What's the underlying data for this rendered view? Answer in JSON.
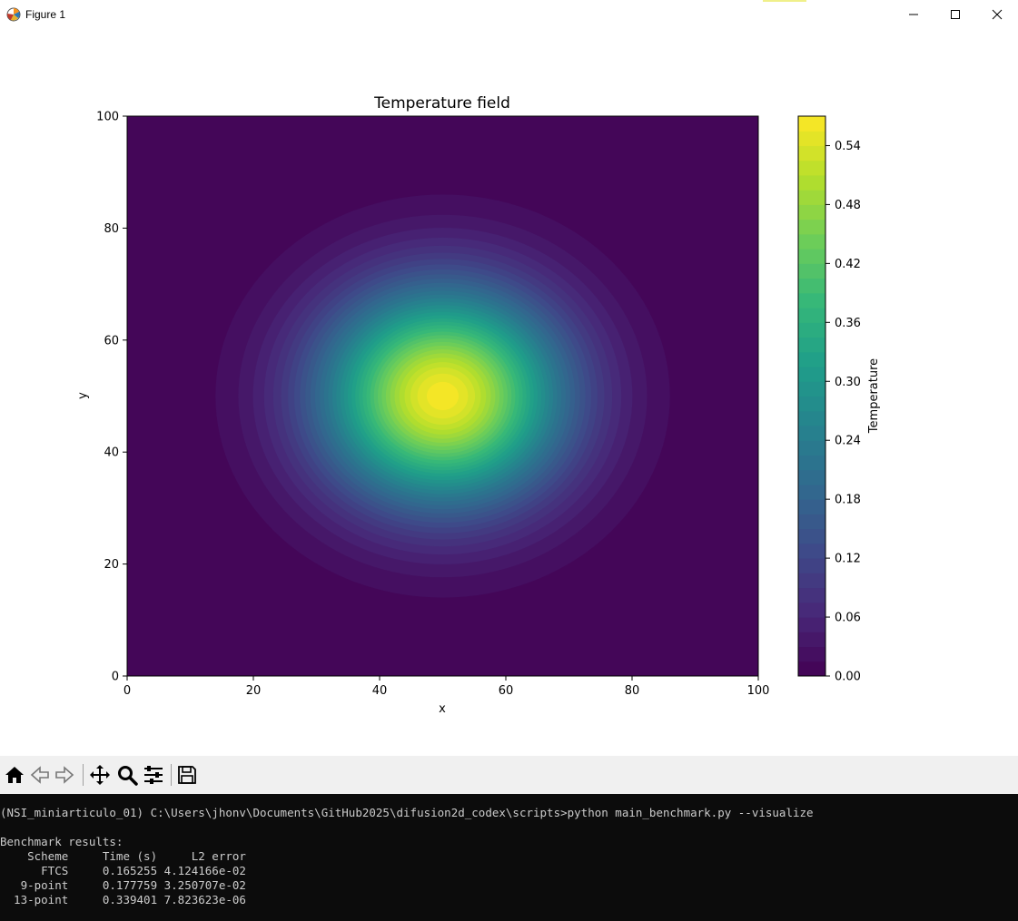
{
  "window": {
    "title": "Figure 1",
    "icons": {
      "app": "matplotlib-icon",
      "minimize": "minimize-icon",
      "maximize": "maximize-icon",
      "close": "close-icon"
    },
    "accent_color": "#f0f08a"
  },
  "toolbar": {
    "icons": [
      "home-icon",
      "back-arrow-icon",
      "forward-arrow-icon",
      "pan-icon",
      "zoom-icon",
      "configure-subplots-icon",
      "save-icon"
    ]
  },
  "chart_data": {
    "type": "heatmap",
    "title": "Temperature field",
    "xlabel": "x",
    "ylabel": "y",
    "xlim": [
      0,
      100
    ],
    "ylim": [
      0,
      100
    ],
    "xticks": [
      0,
      20,
      40,
      60,
      80,
      100
    ],
    "yticks": [
      0,
      20,
      40,
      60,
      80,
      100
    ],
    "field": {
      "peak_value": 0.565,
      "center": [
        50,
        50
      ],
      "outermost_contour_extent": {
        "x": [
          14,
          86
        ],
        "y": [
          14,
          86
        ]
      }
    },
    "colorbar": {
      "label": "Temperature",
      "range": [
        0,
        0.57
      ],
      "levels_step": 0.015,
      "ticks": [
        0.0,
        0.06,
        0.12,
        0.18,
        0.24,
        0.3,
        0.36,
        0.42,
        0.48,
        0.54
      ],
      "tick_labels": [
        "0.00",
        "0.06",
        "0.12",
        "0.18",
        "0.24",
        "0.30",
        "0.36",
        "0.42",
        "0.48",
        "0.54"
      ],
      "colormap": "viridis"
    }
  },
  "console": {
    "prompt_line": "(NSI_miniarticulo_01) C:\\Users\\jhonv\\Documents\\GitHub2025\\difusion2d_codex\\scripts>python main_benchmark.py --visualize",
    "results_title": "Benchmark results:",
    "table_header": "    Scheme     Time (s)     L2 error",
    "rows": [
      "      FTCS     0.165255 4.124166e-02",
      "   9-point     0.177759 3.250707e-02",
      "  13-point     0.339401 7.823623e-06"
    ]
  }
}
